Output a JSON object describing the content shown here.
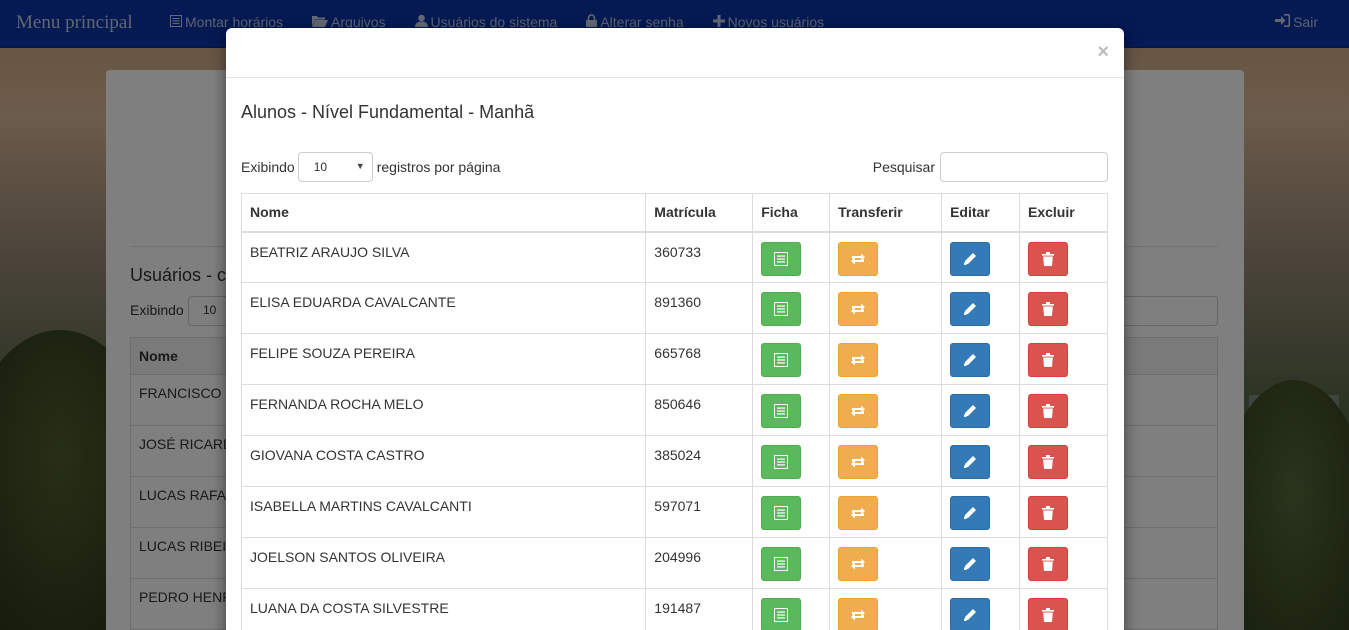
{
  "navbar": {
    "brand": "Menu principal",
    "items": [
      {
        "label": "Montar horários",
        "icon": "list-alt-icon"
      },
      {
        "label": "Arquivos",
        "icon": "folder-open-icon"
      },
      {
        "label": "Usuários do sistema",
        "icon": "user-icon"
      },
      {
        "label": "Alterar senha",
        "icon": "lock-icon"
      },
      {
        "label": "Novos usuários",
        "icon": "plus-icon"
      }
    ],
    "logout": "Sair"
  },
  "background_panel": {
    "title": "Usuários - c",
    "show_label": "Exibindo",
    "page_size": "10",
    "table_header": "Nome",
    "rows": [
      "FRANCISCO",
      "JOSÉ RICARD",
      "LUCAS RAFA",
      "LUCAS RIBEI",
      "PEDRO HENR"
    ]
  },
  "modal": {
    "close_glyph": "×",
    "title": "Alunos - Nível Fundamental - Manhã",
    "length": {
      "prefix": "Exibindo",
      "value": "10",
      "suffix": "registros por página"
    },
    "search_label": "Pesquisar",
    "search_value": "",
    "columns": {
      "nome": "Nome",
      "matricula": "Matrícula",
      "ficha": "Ficha",
      "transferir": "Transferir",
      "editar": "Editar",
      "excluir": "Excluir"
    },
    "students": [
      {
        "nome": "BEATRIZ ARAUJO SILVA",
        "matricula": "360733"
      },
      {
        "nome": "ELISA EDUARDA CAVALCANTE",
        "matricula": "891360"
      },
      {
        "nome": "FELIPE SOUZA PEREIRA",
        "matricula": "665768"
      },
      {
        "nome": "FERNANDA ROCHA MELO",
        "matricula": "850646"
      },
      {
        "nome": "GIOVANA COSTA CASTRO",
        "matricula": "385024"
      },
      {
        "nome": "ISABELLA MARTINS CAVALCANTI",
        "matricula": "597071"
      },
      {
        "nome": "JOELSON SANTOS OLIVEIRA",
        "matricula": "204996"
      },
      {
        "nome": "LUANA DA COSTA SILVESTRE",
        "matricula": "191487"
      }
    ]
  },
  "colors": {
    "navbar": "#0b32a7",
    "success": "#5cb85c",
    "warning": "#f0ad4e",
    "primary": "#337ab7",
    "danger": "#d9534f"
  }
}
